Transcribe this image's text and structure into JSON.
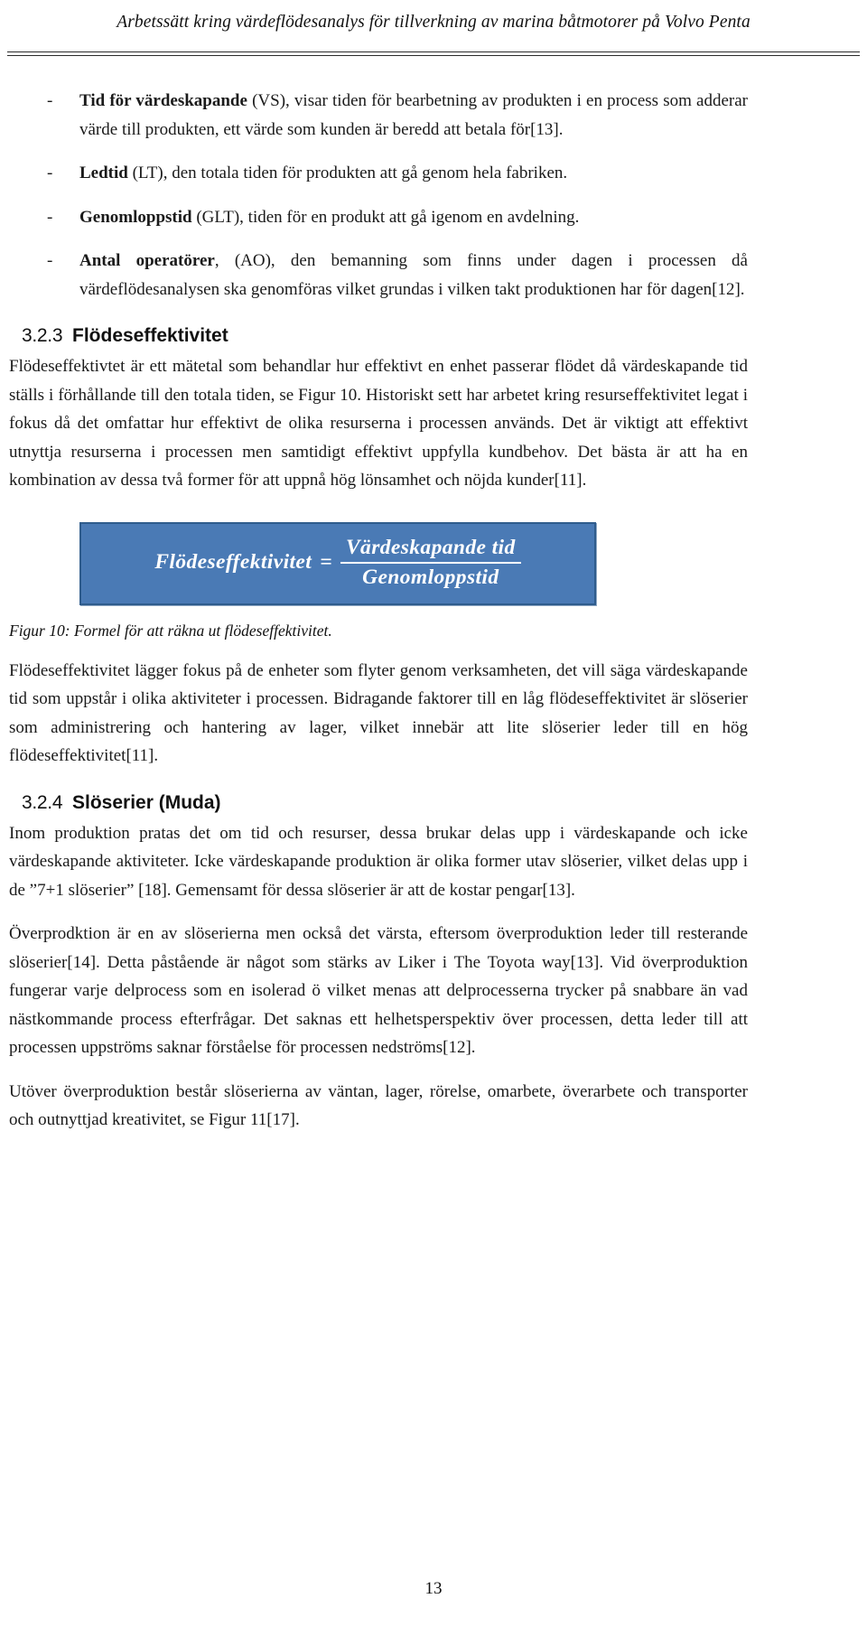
{
  "header": {
    "running_title": "Arbetssätt kring värdeflödesanalys för tillverkning av marina båtmotorer på Volvo Penta"
  },
  "bullets": [
    {
      "marker": "-",
      "term": "Tid för värdeskapande",
      "text": " (VS), visar tiden för bearbetning av produkten i en process som adderar värde till produkten, ett värde som kunden är beredd att betala för[13]."
    },
    {
      "marker": "-",
      "term": "Ledtid",
      "text": " (LT), den totala tiden för produkten att gå genom hela fabriken."
    },
    {
      "marker": "-",
      "term": "Genomloppstid",
      "text": " (GLT), tiden för en produkt att gå igenom en avdelning."
    },
    {
      "marker": "-",
      "term": "Antal operatörer",
      "text": ", (AO), den bemanning som finns under dagen i processen då värdeflödesanalysen ska genomföras vilket grundas i vilken takt produktionen har för dagen[12]."
    }
  ],
  "section_323": {
    "number": "3.2.3",
    "title": "Flödeseffektivitet",
    "paragraph": "Flödeseffektivtet är ett mätetal som behandlar hur effektivt en enhet passerar flödet då värdeskapande tid ställs i förhållande till den totala tiden, se Figur 10. Historiskt sett har arbetet kring resurseffektivitet legat i fokus då det omfattar hur effektivt de olika resurserna i processen används.  Det är viktigt att effektivt utnyttja resurserna i processen men samtidigt effektivt uppfylla kundbehov. Det bästa är att ha en kombination av dessa två former för att uppnå hög lönsamhet och nöjda kunder[11]."
  },
  "formula": {
    "lhs": "Flödeseffektivitet",
    "equals": "=",
    "numerator": "Värdeskapande tid",
    "denominator": "Genomloppstid",
    "box_fill": "#4a7ab5",
    "box_border": "#2f5c8c",
    "text_color": "#ffffff"
  },
  "figure_caption": "Figur 10: Formel för att räkna ut flödeseffektivitet.",
  "paragraph_after_figure": "Flödeseffektivitet lägger fokus på de enheter som flyter genom verksamheten, det vill säga värdeskapande tid som uppstår i olika aktiviteter i processen. Bidragande faktorer till en låg flödeseffektivitet är slöserier som administrering och hantering av lager, vilket innebär att lite slöserier leder till en hög flödeseffektivitet[11].",
  "section_324": {
    "number": "3.2.4",
    "title": "Slöserier (Muda)",
    "paragraphs": [
      "Inom produktion pratas det om tid och resurser, dessa brukar delas upp i värdeskapande och icke värdeskapande aktiviteter. Icke värdeskapande produktion är olika former utav slöserier, vilket delas upp i de ”7+1 slöserier” [18]. Gemensamt för dessa slöserier är att de kostar pengar[13].",
      "Överprodktion är en av slöserierna men också det värsta, eftersom överproduktion leder till resterande slöserier[14]. Detta påstående är något som stärks av Liker i The Toyota way[13]. Vid överproduktion fungerar varje delprocess som en isolerad ö vilket menas att delprocesserna trycker på snabbare än vad nästkommande process efterfrågar. Det saknas ett helhetsperspektiv över processen, detta leder till att processen uppströms saknar förståelse för processen nedströms[12].",
      "Utöver överproduktion består slöserierna av väntan, lager, rörelse, omarbete, överarbete och transporter och outnyttjad kreativitet, se Figur 11[17]."
    ]
  },
  "page_number": "13"
}
